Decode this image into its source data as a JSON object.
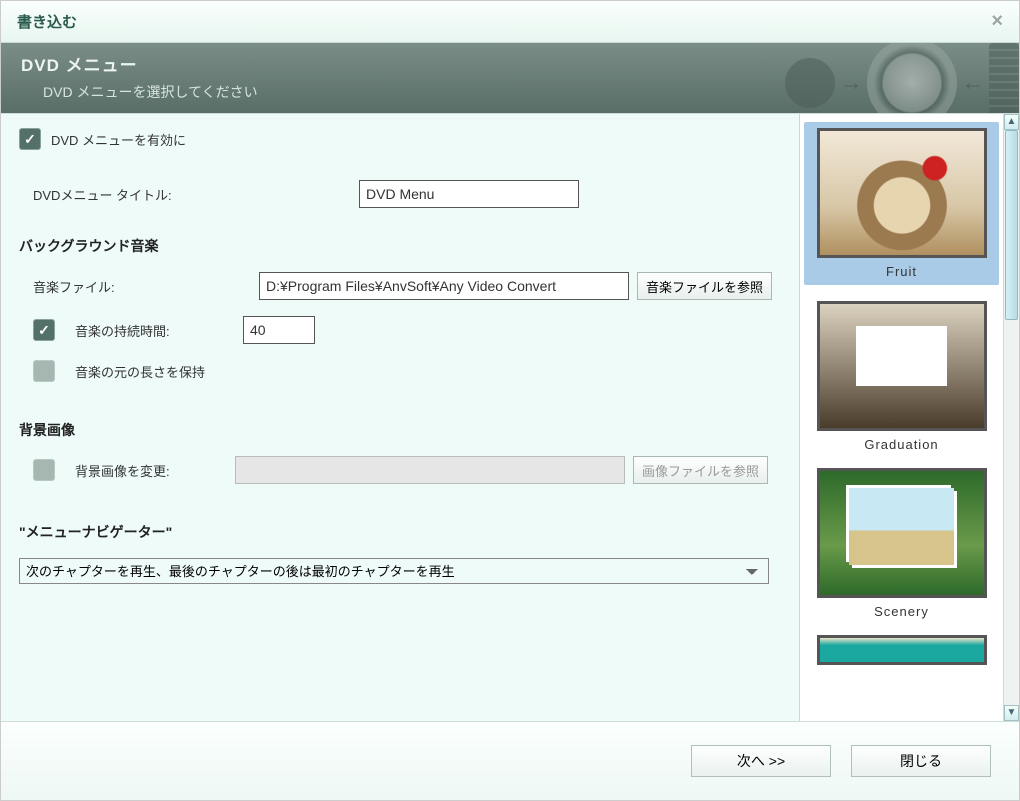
{
  "window": {
    "title": "書き込む"
  },
  "header": {
    "title": "DVD メニュー",
    "subtitle": "DVD メニューを選択してください"
  },
  "form": {
    "enable_menu": {
      "label": "DVD メニューを有効に",
      "checked": true
    },
    "title_label": "DVDメニュー タイトル:",
    "title_value": "DVD Menu",
    "bg_music_section": "バックグラウンド音楽",
    "music_file_label": "音楽ファイル:",
    "music_file_value": "D:¥Program Files¥AnvSoft¥Any Video Convert",
    "browse_music_label": "音楽ファイルを参照",
    "music_duration": {
      "label": "音楽の持続時間:",
      "value": "40",
      "checked": true
    },
    "keep_length": {
      "label": "音楽の元の長さを保持",
      "checked": false
    },
    "bg_image_section": "背景画像",
    "change_bg": {
      "label": "背景画像を変更:",
      "checked": false
    },
    "browse_image_label": "画像ファイルを参照",
    "navigator_section": "\"メニューナビゲーター\"",
    "navigator_value": "次のチャプターを再生、最後のチャプターの後は最初のチャプターを再生"
  },
  "templates": [
    {
      "name": "Fruit",
      "selected": true
    },
    {
      "name": "Graduation",
      "selected": false
    },
    {
      "name": "Scenery",
      "selected": false
    }
  ],
  "footer": {
    "next": "次へ >>",
    "close": "閉じる"
  }
}
